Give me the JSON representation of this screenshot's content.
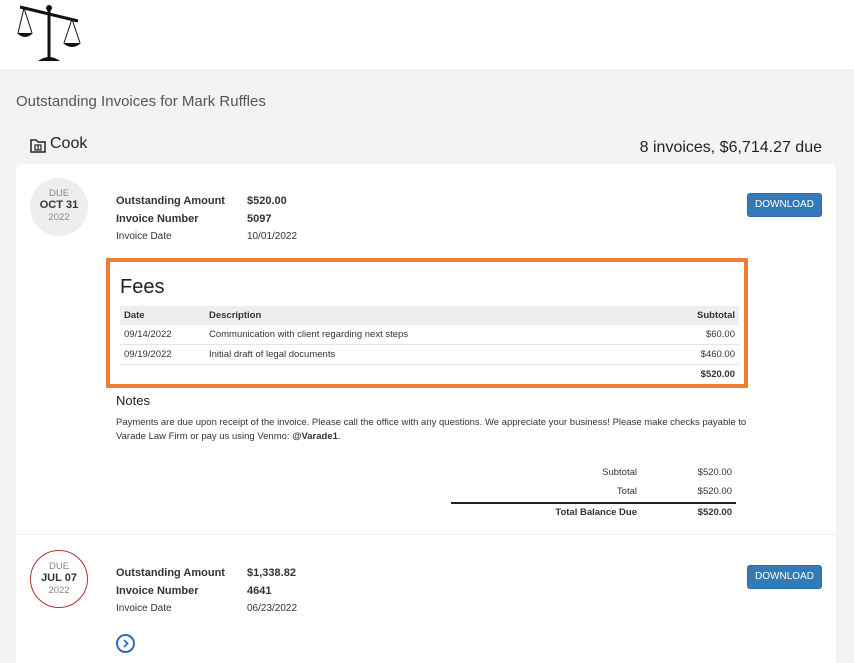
{
  "page": {
    "title": "Outstanding Invoices for Mark Ruffles"
  },
  "logo": {
    "icon": "scales-of-justice-icon"
  },
  "client": {
    "icon": "folder-icon",
    "name": "Cook",
    "summary": "8 invoices, $6,714.27 due"
  },
  "invoices": [
    {
      "due_label": "DUE",
      "due_date": "OCT 31",
      "due_year": "2022",
      "outstanding_label": "Outstanding Amount",
      "outstanding_value": "$520.00",
      "number_label": "Invoice Number",
      "number_value": "5097",
      "date_label": "Invoice Date",
      "date_value": "10/01/2022",
      "download_label": "DOWNLOAD",
      "fees": {
        "title": "Fees",
        "headers": {
          "date": "Date",
          "description": "Description",
          "subtotal": "Subtotal"
        },
        "rows": [
          {
            "date": "09/14/2022",
            "description": "Communication with client regarding next steps",
            "subtotal": "$60.00"
          },
          {
            "date": "09/19/2022",
            "description": "Initial draft of legal documents",
            "subtotal": "$460.00"
          }
        ],
        "total": "$520.00"
      },
      "notes": {
        "title": "Notes",
        "text": "Payments are due upon receipt of the invoice. Please call the office with any questions. We appreciate your business! Please make checks payable to Varade Law Firm or pay us using Venmo: ",
        "venmo": "@Varade1",
        "end": "."
      },
      "totals": {
        "subtotal_label": "Subtotal",
        "subtotal_value": "$520.00",
        "total_label": "Total",
        "total_value": "$520.00",
        "balance_label": "Total Balance Due",
        "balance_value": "$520.00"
      }
    },
    {
      "due_label": "DUE",
      "due_date": "JUL 07",
      "due_year": "2022",
      "status_color": "#b03030",
      "outstanding_label": "Outstanding Amount",
      "outstanding_value": "$1,338.82",
      "number_label": "Invoice Number",
      "number_value": "4641",
      "date_label": "Invoice Date",
      "date_value": "06/23/2022",
      "download_label": "DOWNLOAD",
      "expand_icon": "chevron-right-circle-icon"
    }
  ],
  "colors": {
    "accent": "#337ab7",
    "highlight_border": "#f07d32",
    "overdue": "#b03030"
  }
}
